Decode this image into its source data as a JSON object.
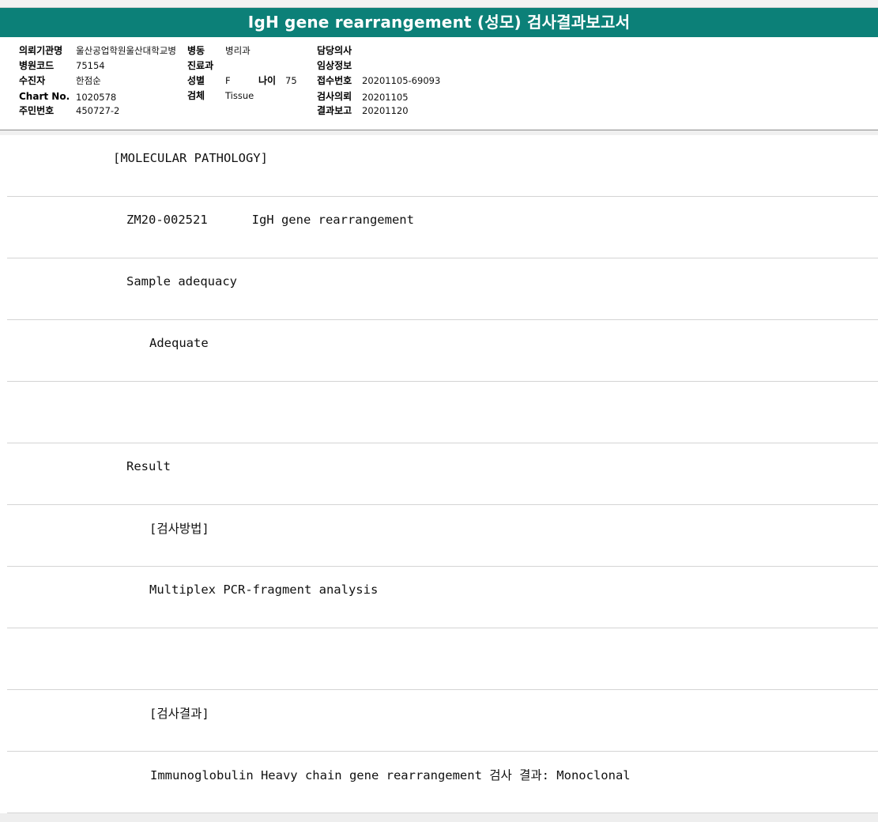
{
  "title": "IgH gene rearrangement (성모) 검사결과보고서",
  "header": {
    "institution_label": "의뢰기관명",
    "institution_value": "울산공업학원울산대학교병",
    "ward_label": "병동",
    "ward_value": "병리과",
    "doctor_label": "담당의사",
    "doctor_value": "",
    "hospital_code_label": "병원코드",
    "hospital_code_value": "75154",
    "department_label": "진료과",
    "department_value": "",
    "clinical_info_label": "임상정보",
    "clinical_info_value": "",
    "patient_label": "수진자",
    "patient_value": "한점순",
    "sex_label": "성별",
    "sex_value": "F",
    "age_label": "나이",
    "age_value": "75",
    "receipt_label": "접수번호",
    "receipt_value": "20201105-69093",
    "chart_label": "Chart No.",
    "chart_value": "1020578",
    "specimen_label": "검체",
    "specimen_value": "Tissue",
    "request_label": "검사의뢰",
    "request_value": "20201105",
    "id_label": "주민번호",
    "id_value": "450727-2",
    "report_label": "결과보고",
    "report_value": "20201120"
  },
  "report_lines": [
    "[MOLECULAR PATHOLOGY]",
    "ZM20-002521      IgH gene rearrangement",
    "Sample adequacy",
    "Adequate",
    "",
    "Result",
    "[검사방법]",
    "Multiplex PCR-fragment analysis",
    "",
    "[검사결과]",
    "Immunoglobulin Heavy chain gene rearrangement 검사 결과: Monoclonal"
  ],
  "colors": {
    "title_bg": "#0c8078",
    "title_text": "#ffffff"
  }
}
